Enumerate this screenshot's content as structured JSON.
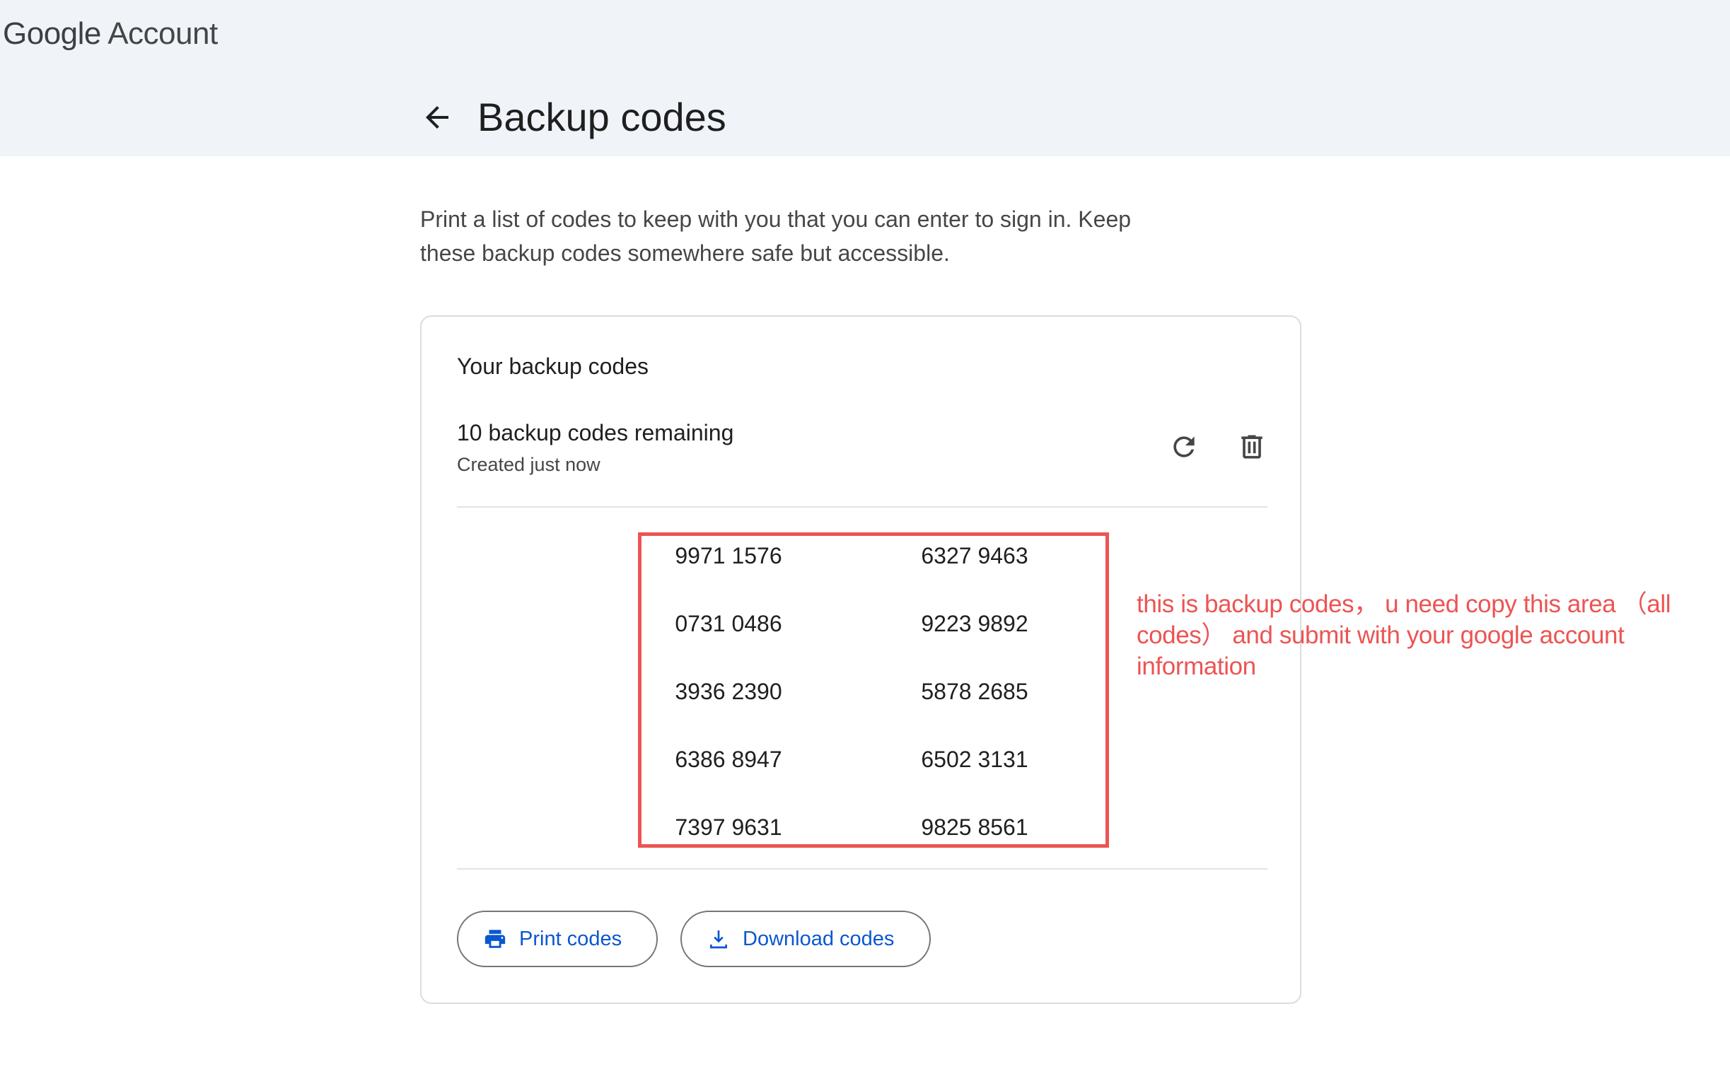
{
  "header": {
    "brand_google": "Google",
    "brand_account": "Account",
    "page_title": "Backup codes",
    "back_icon": "arrow-back-icon"
  },
  "intro": {
    "text": "Print a list of codes to keep with you that you can enter to sign in. Keep these backup codes somewhere safe but accessible."
  },
  "card": {
    "title": "Your backup codes",
    "remaining": "10 backup codes remaining",
    "created": "Created just now",
    "refresh_icon": "refresh-icon",
    "delete_icon": "trash-icon",
    "codes": [
      "9971 1576",
      "6327 9463",
      "0731 0486",
      "9223 9892",
      "3936 2390",
      "5878 2685",
      "6386 8947",
      "6502 3131",
      "7397 9631",
      "9825 8561"
    ],
    "print_label": "Print codes",
    "print_icon": "print-icon",
    "download_label": "Download codes",
    "download_icon": "download-icon"
  },
  "annotation": {
    "text": "this is backup codes， u need copy this area （all codes） and submit with your google account information",
    "color": "#ec5453"
  },
  "colors": {
    "header_bg": "#f0f4f9",
    "accent": "#0b57d0",
    "highlight": "#ec5453"
  }
}
